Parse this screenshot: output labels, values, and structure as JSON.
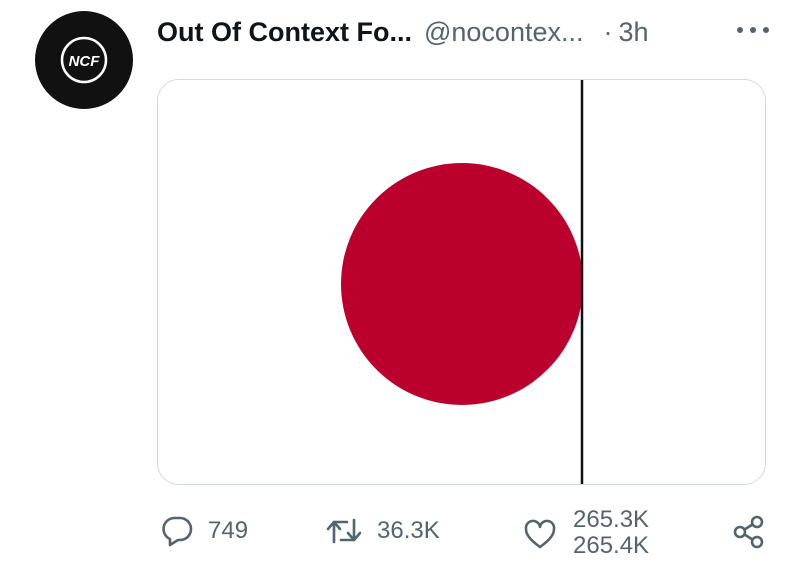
{
  "tweet": {
    "avatar_label": "NCF",
    "display_name": "Out Of Context Fo...",
    "handle": "@nocontex...",
    "separator": "·",
    "time": "3h"
  },
  "actions": {
    "replies": "749",
    "retweets": "36.3K",
    "likes_current": "265.3K",
    "likes_next": "265.4K"
  },
  "media": {
    "description_colors": {
      "disc": "#bc002d",
      "line": "#111111",
      "background": "#ffffff"
    }
  },
  "icons": [
    "ncf-logo",
    "more-icon",
    "reply-icon",
    "retweet-icon",
    "like-icon",
    "share-icon"
  ],
  "colors": {
    "text_primary": "#0f1419",
    "text_secondary": "#536471",
    "border": "#cfd9de"
  }
}
